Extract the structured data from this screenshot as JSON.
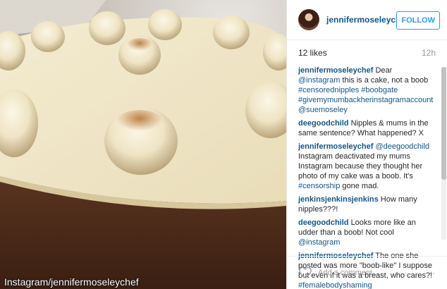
{
  "post": {
    "username": "jennifermoseleychef",
    "follow_label": "FOLLOW",
    "likes": "12 likes",
    "time": "12h",
    "add_comment_placeholder": "Add a comment...",
    "more_label": "···",
    "watermark": "Instagram/jennifermoseleychef"
  },
  "comments": [
    {
      "user": "jennifermoseleychef",
      "parts": [
        {
          "t": "Dear ",
          "link": false
        },
        {
          "t": "@instagram",
          "link": true
        },
        {
          "t": " this is a cake, not a boob ",
          "link": false
        },
        {
          "t": "#censorednipples #boobgate #givemymumbackherinstagramaccount @suemoseley",
          "link": true
        }
      ]
    },
    {
      "user": "deegoodchild",
      "parts": [
        {
          "t": "Nipples & mums in the same sentence? What happened? X",
          "link": false
        }
      ]
    },
    {
      "user": "jennifermoseleychef",
      "parts": [
        {
          "t": "@deegoodchild",
          "link": true
        },
        {
          "t": " Instagram deactivated my mums Instagram because they thought her photo of my cake was a boob. It's ",
          "link": false
        },
        {
          "t": "#censorship",
          "link": true
        },
        {
          "t": " gone mad.",
          "link": false
        }
      ]
    },
    {
      "user": "jenkinsjenkinsjenkins",
      "parts": [
        {
          "t": "How many nipples???!",
          "link": false
        }
      ]
    },
    {
      "user": "deegoodchild",
      "parts": [
        {
          "t": "Looks more like an udder than a boob! Not cool ",
          "link": false
        },
        {
          "t": "@instagram",
          "link": true
        }
      ]
    },
    {
      "user": "jennifermoseleychef",
      "parts": [
        {
          "t": "The one she posted was more \"boob-like\" I suppose but even if it was a breast, who cares?! ",
          "link": false
        },
        {
          "t": "#femalebodyshaming",
          "link": true
        }
      ]
    }
  ],
  "colors": {
    "username": "#125688",
    "follow": "#3897f0",
    "muted": "#999999"
  }
}
